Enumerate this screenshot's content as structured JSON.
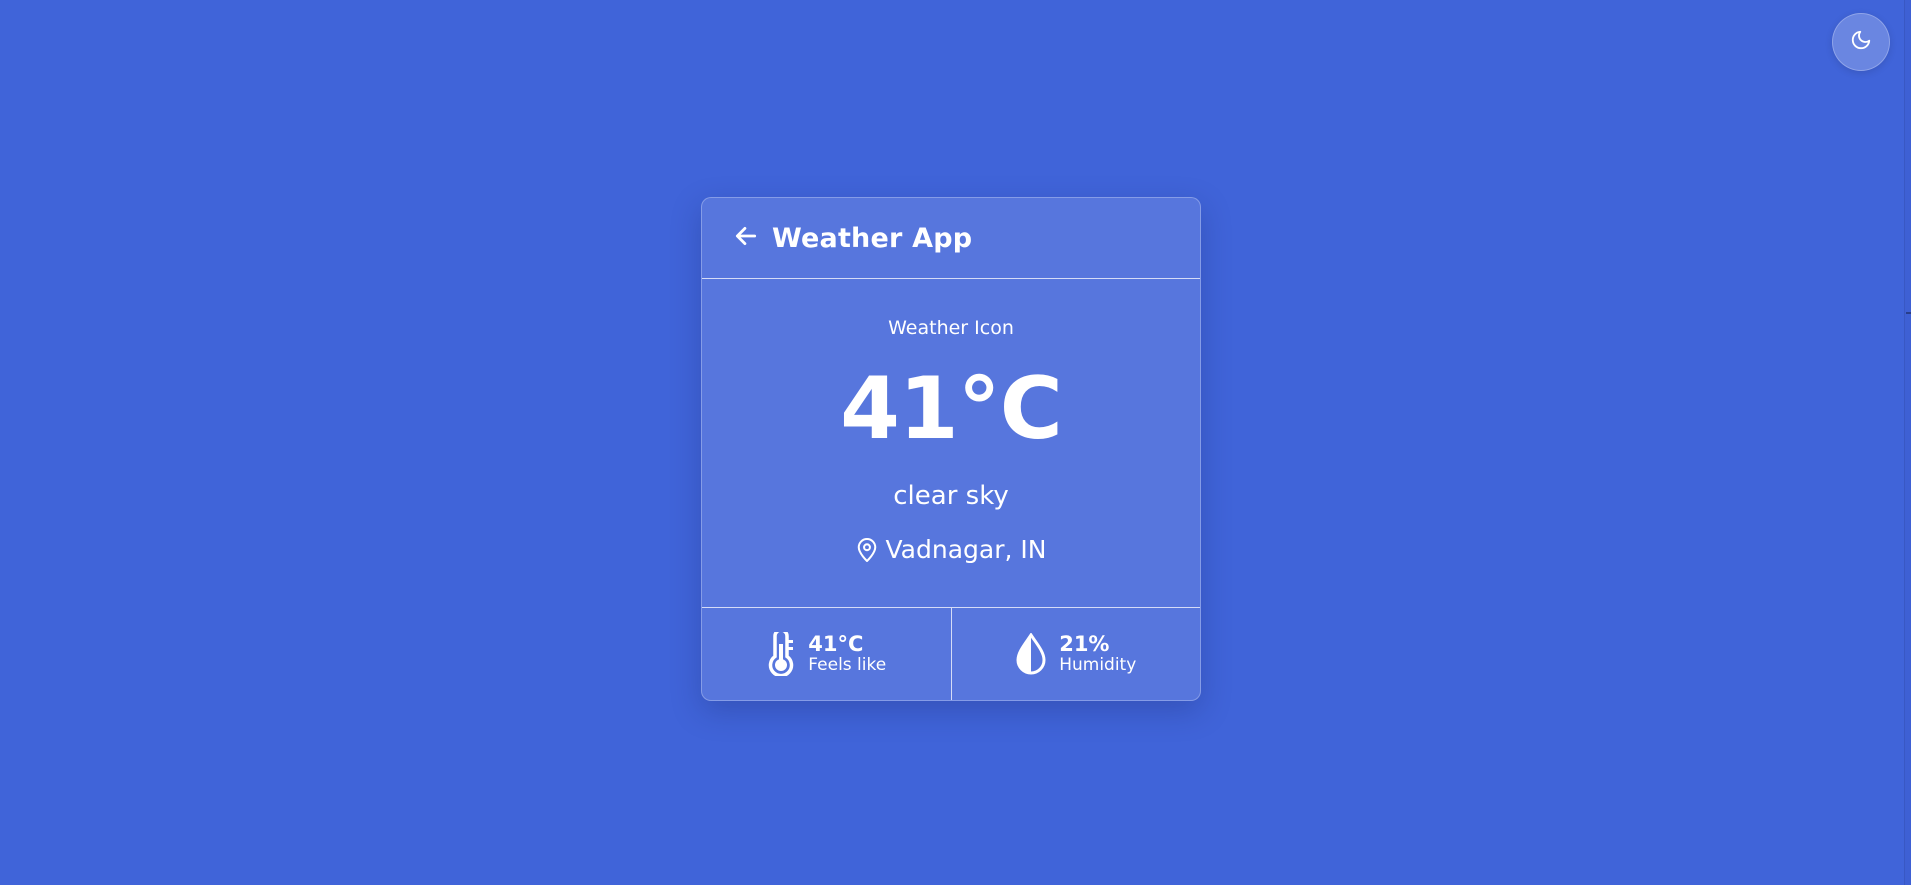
{
  "app": {
    "title": "Weather App"
  },
  "theme": {
    "toggle_icon": "moon-icon",
    "background": "#4064d9"
  },
  "weather": {
    "icon_alt": "Weather Icon",
    "temperature": "41°C",
    "description": "clear sky",
    "location": "Vadnagar, IN"
  },
  "stats": {
    "feels_like": {
      "icon": "thermometer-icon",
      "value": "41°C",
      "label": "Feels like"
    },
    "humidity": {
      "icon": "water-drop-icon",
      "value": "21%",
      "label": "Humidity"
    }
  }
}
